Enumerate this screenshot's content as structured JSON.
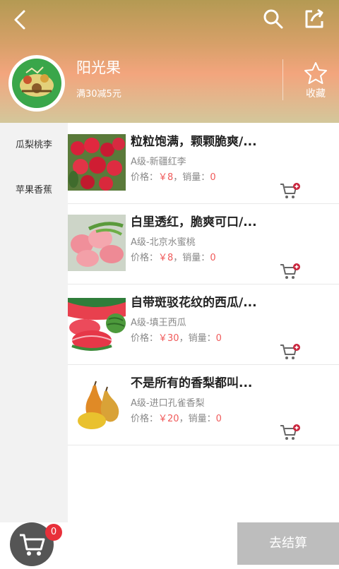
{
  "header": {
    "store_name": "阳光果",
    "promo": "满30减5元",
    "favorite_label": "收藏"
  },
  "sidebar": {
    "categories": [
      {
        "label": "瓜梨桃李"
      },
      {
        "label": "苹果香蕉"
      }
    ]
  },
  "products": [
    {
      "title": "粒粒饱满，颗颗脆爽/...",
      "subtitle": "A级-新疆红李",
      "price_label": "价格：",
      "price": "￥8",
      "sales_label": "，销量：",
      "sales": "0"
    },
    {
      "title": "白里透红，脆爽可口/...",
      "subtitle": "A级-北京水蜜桃",
      "price_label": "价格：",
      "price": "￥8",
      "sales_label": "，销量：",
      "sales": "0"
    },
    {
      "title": "自带斑驳花纹的西瓜/...",
      "subtitle": "A级-填王西瓜",
      "price_label": "价格：",
      "price": "￥30",
      "sales_label": "，销量：",
      "sales": "0"
    },
    {
      "title": "不是所有的香梨都叫...",
      "subtitle": "A级-进口孔雀香梨",
      "price_label": "价格：",
      "price": "￥20",
      "sales_label": "，销量：",
      "sales": "0"
    }
  ],
  "cart": {
    "count": "0",
    "checkout_label": "去结算"
  },
  "colors": {
    "accent_red": "#f05a5a",
    "badge_red": "#e8303a",
    "checkout_bg": "#bdbdbd"
  },
  "icons": [
    "back-arrow-icon",
    "search-icon",
    "share-icon",
    "star-icon",
    "cart-add-icon",
    "cart-icon"
  ]
}
